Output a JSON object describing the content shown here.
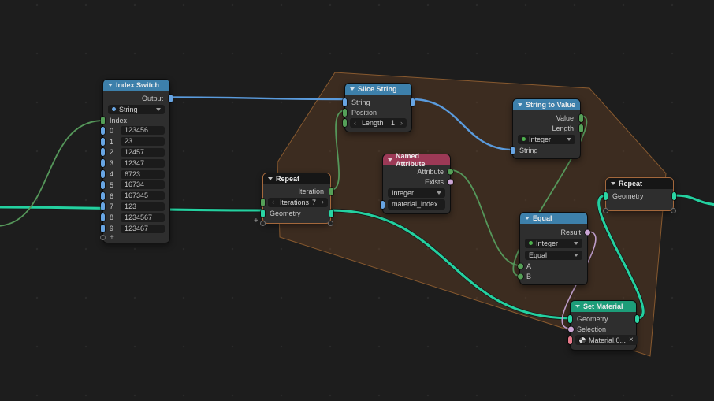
{
  "nodes": {
    "index_switch": {
      "title": "Index Switch",
      "output_label": "Output",
      "data_type": "String",
      "index_label": "Index",
      "items": [
        {
          "index": "0",
          "value": "123456"
        },
        {
          "index": "1",
          "value": "23"
        },
        {
          "index": "2",
          "value": "12457"
        },
        {
          "index": "3",
          "value": "12347"
        },
        {
          "index": "4",
          "value": "6723"
        },
        {
          "index": "5",
          "value": "16734"
        },
        {
          "index": "6",
          "value": "167345"
        },
        {
          "index": "7",
          "value": "123"
        },
        {
          "index": "8",
          "value": "1234567"
        },
        {
          "index": "9",
          "value": "123467"
        }
      ],
      "add_item_label": "+"
    },
    "slice_string": {
      "title": "Slice String",
      "string_label": "String",
      "position_label": "Position",
      "length_label": "Length",
      "length_value": "1"
    },
    "string_to_value": {
      "title": "String to Value",
      "value_label": "Value",
      "length_label": "Length",
      "data_type": "Integer",
      "string_label": "String"
    },
    "named_attribute": {
      "title": "Named Attribute",
      "attribute_label": "Attribute",
      "exists_label": "Exists",
      "data_type": "Integer",
      "attribute_name": "material_index"
    },
    "repeat_input": {
      "title": "Repeat",
      "iteration_label": "Iteration",
      "iterations_label": "Iterations",
      "iterations_value": "7",
      "geometry_label": "Geometry",
      "add_item_label": "+"
    },
    "equal": {
      "title": "Equal",
      "result_label": "Result",
      "data_type": "Integer",
      "operation": "Equal",
      "a_label": "A",
      "b_label": "B"
    },
    "set_material": {
      "title": "Set Material",
      "geometry_label": "Geometry",
      "selection_label": "Selection",
      "material_name": "Material.0...",
      "clear_label": "×"
    },
    "repeat_output": {
      "title": "Repeat",
      "geometry_label": "Geometry"
    }
  },
  "colors": {
    "background": "#1d1d1d",
    "node_body": "#2e2e2e",
    "header_converter_blue": "#3d80ab",
    "header_input_red": "#9c3956",
    "header_geometry_teal": "#1d9d79",
    "header_zone_dark": "#161616",
    "zone_fill": "#684225",
    "zone_border": "#c47d3b",
    "wire_string_blue": "#5a9bdd",
    "wire_integer_green": "#55975a",
    "wire_geometry_teal": "#24d1a0",
    "wire_boolean_pink": "#bf9ecb",
    "socket_string": "#68a5e3",
    "socket_integer": "#55a058",
    "socket_geometry": "#2ad5a4",
    "socket_boolean": "#cca6d6",
    "socket_material": "#e8798a"
  }
}
